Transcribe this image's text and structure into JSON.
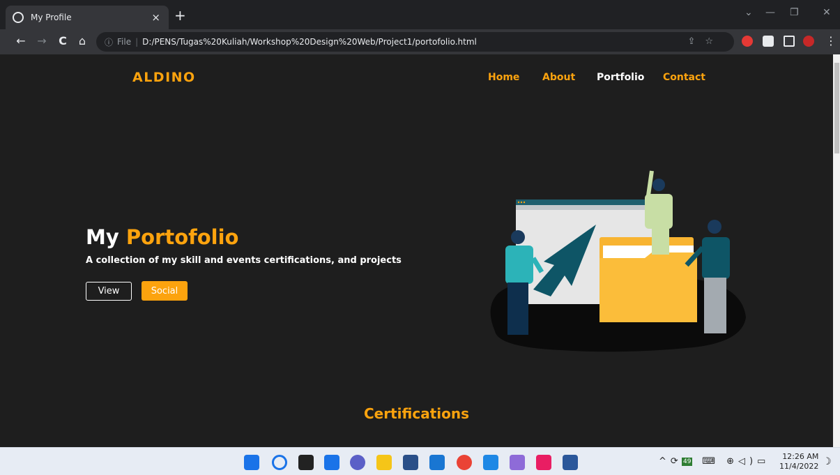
{
  "browser": {
    "tab_title": "My Profile",
    "tab_close": "×",
    "new_tab": "+",
    "window_controls": {
      "dropdown": "⌄",
      "minimize": "—",
      "restore": "❐",
      "close": "✕"
    },
    "nav": {
      "back": "←",
      "forward": "→",
      "reload": "C",
      "home": "⌂"
    },
    "address": {
      "info_icon": "ⓘ",
      "scheme_label": "File",
      "separator": "|",
      "url": "D:/PENS/Tugas%20Kuliah/Workshop%20Design%20Web/Project1/portofolio.html",
      "right_icons": "⇪☆"
    },
    "menu": "⋮"
  },
  "site": {
    "logo": "ALDINO",
    "nav": [
      {
        "label": "Home"
      },
      {
        "label": "About"
      },
      {
        "label": "Portfolio"
      },
      {
        "label": "Contact"
      }
    ],
    "hero": {
      "title_plain": "My ",
      "title_highlight": "Portofolio",
      "subtitle": "A collection of my skill and events certifications, and projects",
      "btn_view": "View",
      "btn_social": "Social"
    },
    "section_title": "Certifications",
    "accent_color": "#fca30e",
    "background_color": "#1e1e1e"
  },
  "taskbar": {
    "tray_text": "^⟳▦ ⌨ ⊕◁)▭",
    "badge": "49",
    "time": "12:26 AM",
    "date": "11/4/2022",
    "moon": "☽"
  }
}
